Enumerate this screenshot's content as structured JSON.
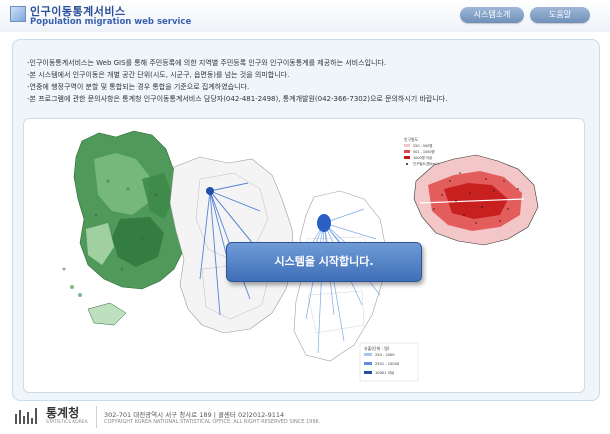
{
  "header": {
    "title_ko": "인구이동통계서비스",
    "title_en": "Population migration web service",
    "nav": [
      {
        "label": "시스템소개"
      },
      {
        "label": "도움말"
      }
    ]
  },
  "description": [
    "-인구이동통계서비스는 Web GIS를 통해 주민등록에 의한 지역별 주민등록 인구와 인구이동통계를 제공하는 서비스입니다.",
    "-본 시스템에서 인구이동은 개별 공간 단위(시도, 시군구, 읍면동)를 넘는 것을 의미합니다.",
    "-연중에 행정구역이 분할 및 통합되는 경우 통합을 기준으로 집계하였습니다.",
    "-본 프로그램에 관한 문의사항은 통계청 인구이동통계서비스 담당자(042-481-2498), 통계개발원(042-366-7302)으로 문의하시기 바랍니다."
  ],
  "start_button": "시스템을 시작합니다.",
  "legend_flow": {
    "title": "유출(단위 : 명)",
    "items": [
      "250 - 2500",
      "2501 - 10000",
      "10001 이상"
    ]
  },
  "legend_density": {
    "title": "인구밀도",
    "items": [
      "250 - 500명",
      "501 - 1000명",
      "1000명 이상",
      "인구밀도(명/km²)"
    ]
  },
  "footer": {
    "org": "통계청",
    "org_en": "STATISTICS KOREA",
    "address": "302-701 대전광역시 서구 청사로 189 | 콜센터 02)2012-9114",
    "copyright": "COPYRIGHT KOREA NATIONAL STATISTICAL OFFICE. ALL RIGHT RESERVED SINCE 1996."
  },
  "colors": {
    "brand_blue": "#2a4f9a",
    "button_blue": "#4a7cc4",
    "map_green": "#3f8f4a",
    "flow_blue": "#3a6fd0",
    "density_red": "#d42020"
  }
}
